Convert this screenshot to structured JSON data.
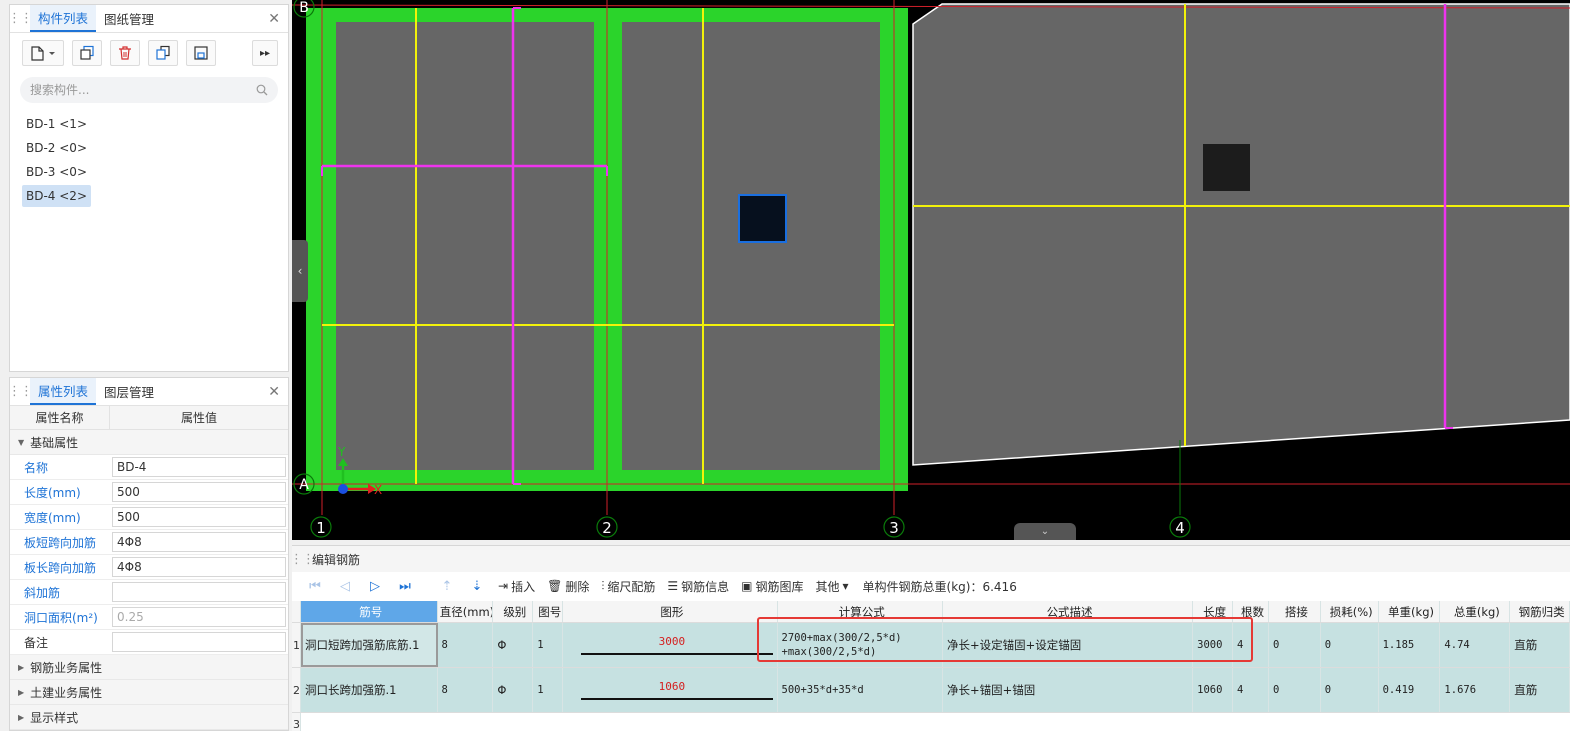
{
  "left_top": {
    "tabs": [
      "构件列表",
      "图纸管理"
    ],
    "search_placeholder": "搜索构件...",
    "components": [
      "BD-1 <1>",
      "BD-2 <0>",
      "BD-3 <0>",
      "BD-4 <2>"
    ],
    "selected_index": 3
  },
  "left_bottom": {
    "tabs": [
      "属性列表",
      "图层管理"
    ],
    "head_name": "属性名称",
    "head_value": "属性值",
    "group_basic": "基础属性",
    "props": [
      {
        "name": "名称",
        "value": "BD-4"
      },
      {
        "name": "长度(mm)",
        "value": "500"
      },
      {
        "name": "宽度(mm)",
        "value": "500"
      },
      {
        "name": "板短跨向加筋",
        "value": "4Φ8"
      },
      {
        "name": "板长跨向加筋",
        "value": "4Φ8"
      },
      {
        "name": "斜加筋",
        "value": ""
      },
      {
        "name": "洞口面积(m²)",
        "value": "0.25"
      },
      {
        "name": "备注",
        "value": ""
      }
    ],
    "groups_collapsed": [
      "钢筋业务属性",
      "土建业务属性",
      "显示样式"
    ]
  },
  "canvas": {
    "axis_labels": [
      "1",
      "2",
      "3",
      "4"
    ],
    "row_labels": [
      "B",
      "A"
    ],
    "x_label": "X",
    "y_label": "Y"
  },
  "editor": {
    "title": "编辑钢筋",
    "actions": {
      "insert": "插入",
      "delete": "删除",
      "scale": "缩尺配筋",
      "info": "钢筋信息",
      "library": "钢筋图库",
      "other": "其他"
    },
    "total_label": "单构件钢筋总重(kg)：6.416",
    "columns": [
      "筋号",
      "直径(mm)",
      "级别",
      "图号",
      "图形",
      "计算公式",
      "公式描述",
      "长度",
      "根数",
      "搭接",
      "损耗(%)",
      "单重(kg)",
      "总重(kg)",
      "钢筋归类"
    ],
    "rows": [
      {
        "idx": "1",
        "no": "洞口短跨加强筋底筋.1",
        "dia": "8",
        "level": "Φ",
        "fig": "1",
        "shape": "3000",
        "formula": [
          "2700+max(300/2,5*d)",
          "+max(300/2,5*d)"
        ],
        "desc": "净长+设定锚固+设定锚固",
        "length": "3000",
        "count": "4",
        "lap": "0",
        "loss": "0",
        "unit": "1.185",
        "total": "4.74",
        "cls": "直筋"
      },
      {
        "idx": "2",
        "no": "洞口长跨加强筋.1",
        "dia": "8",
        "level": "Φ",
        "fig": "1",
        "shape": "1060",
        "formula": [
          "500+35*d+35*d"
        ],
        "desc": "净长+锚固+锚固",
        "length": "1060",
        "count": "4",
        "lap": "0",
        "loss": "0",
        "unit": "0.419",
        "total": "1.676",
        "cls": "直筋"
      }
    ],
    "empty_row_idx": "3"
  },
  "colors": {
    "accent": "#1e73d6",
    "rebar_green": "#2bd42b",
    "axis_yellow": "#f2f20a",
    "rebar_magenta": "#ee33ee",
    "slab_gray": "#666666",
    "highlight_red": "#e53935"
  }
}
